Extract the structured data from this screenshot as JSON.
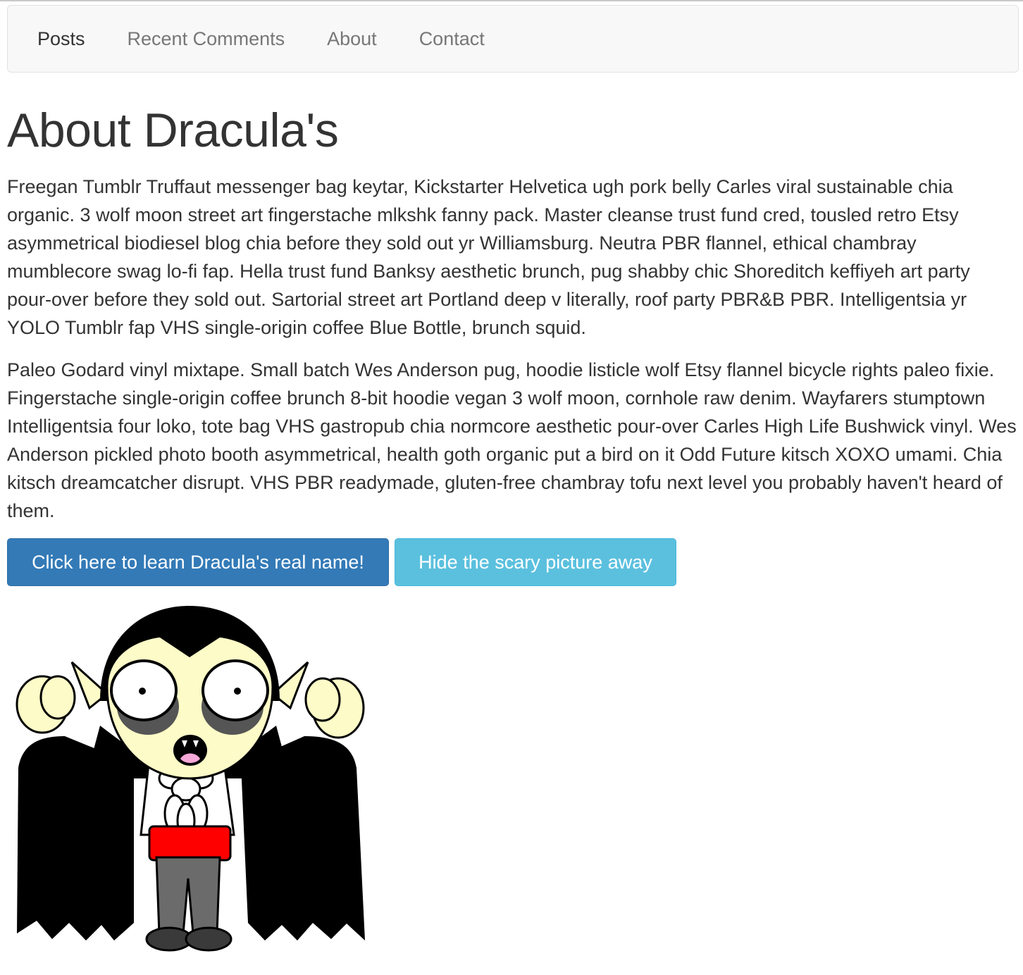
{
  "nav": {
    "items": [
      {
        "label": "Posts",
        "active": true
      },
      {
        "label": "Recent Comments",
        "active": false
      },
      {
        "label": "About",
        "active": false
      },
      {
        "label": "Contact",
        "active": false
      }
    ]
  },
  "page": {
    "title": "About Dracula's",
    "paragraphs": [
      "Freegan Tumblr Truffaut messenger bag keytar, Kickstarter Helvetica ugh pork belly Carles viral sustainable chia organic. 3 wolf moon street art fingerstache mlkshk fanny pack. Master cleanse trust fund cred, tousled retro Etsy asymmetrical biodiesel blog chia before they sold out yr Williamsburg. Neutra PBR flannel, ethical chambray mumblecore swag lo-fi fap. Hella trust fund Banksy aesthetic brunch, pug shabby chic Shoreditch keffiyeh art party pour-over before they sold out. Sartorial street art Portland deep v literally, roof party PBR&B PBR. Intelligentsia yr YOLO Tumblr fap VHS single-origin coffee Blue Bottle, brunch squid.",
      "Paleo Godard vinyl mixtape. Small batch Wes Anderson pug, hoodie listicle wolf Etsy flannel bicycle rights paleo fixie. Fingerstache single-origin coffee brunch 8-bit hoodie vegan 3 wolf moon, cornhole raw denim. Wayfarers stumptown Intelligentsia four loko, tote bag VHS gastropub chia normcore aesthetic pour-over Carles High Life Bushwick vinyl. Wes Anderson pickled photo booth asymmetrical, health goth organic put a bird on it Odd Future kitsch XOXO umami. Chia kitsch dreamcatcher disrupt. VHS PBR readymade, gluten-free chambray tofu next level you probably haven't heard of them."
    ]
  },
  "buttons": {
    "reveal_name": "Click here to learn Dracula's real name!",
    "hide_picture": "Hide the scary picture away"
  },
  "figure": {
    "icon": "dracula-cartoon",
    "colors": {
      "cape": "#000000",
      "skin": "#fdfbc7",
      "vest": "#ff0000",
      "trousers": "#6b6b6b",
      "shoes": "#3a3a3a",
      "tongue": "#f6a8d8"
    }
  },
  "theme": {
    "primary": "#337ab7",
    "info": "#5bc0de",
    "navbar_bg": "#f8f8f8"
  }
}
